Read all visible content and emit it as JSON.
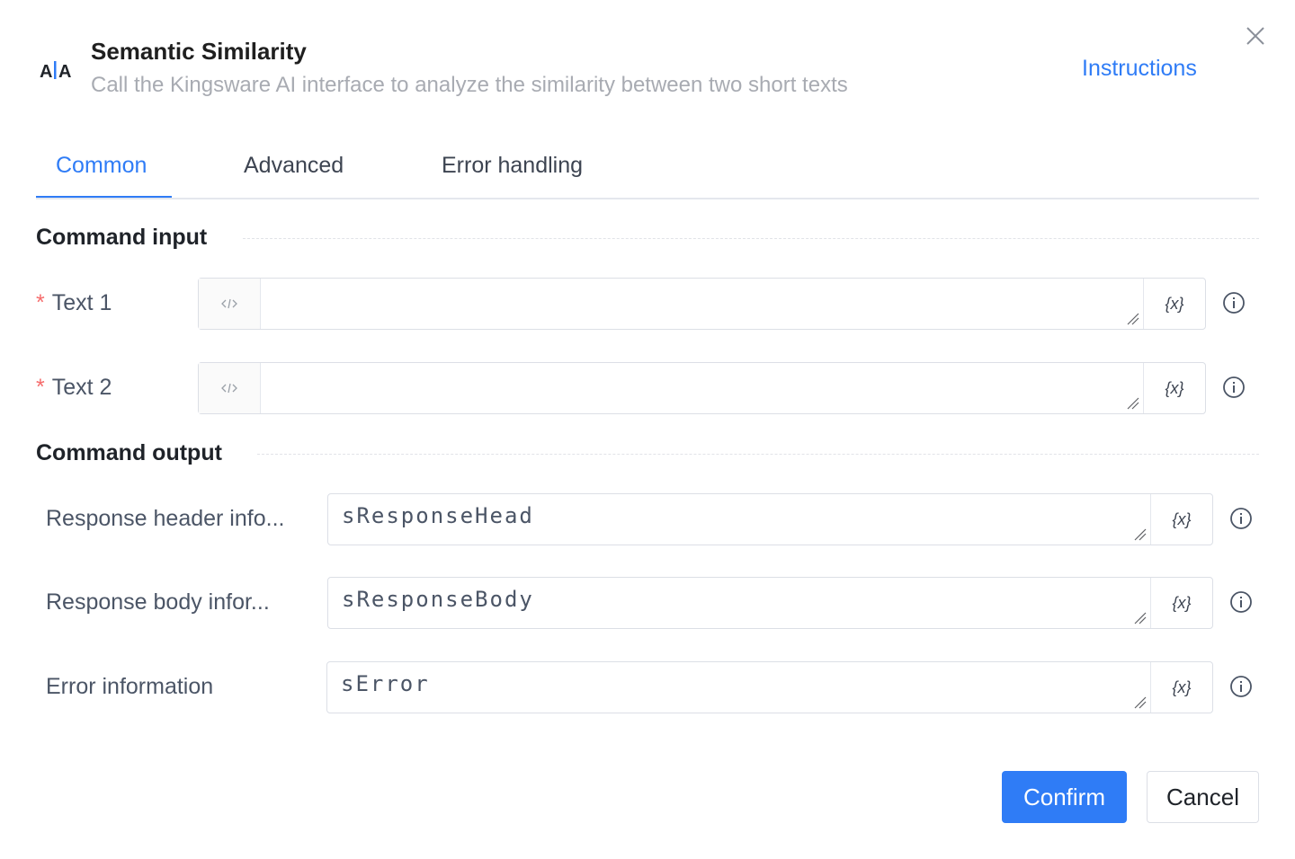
{
  "header": {
    "icon": "ai-text-compare-icon",
    "title": "Semantic Similarity",
    "subtitle": "Call the Kingsware AI interface to analyze the similarity between two short texts",
    "instructions_label": "Instructions"
  },
  "tabs": [
    {
      "label": "Common",
      "active": true
    },
    {
      "label": "Advanced",
      "active": false
    },
    {
      "label": "Error handling",
      "active": false
    }
  ],
  "input_section": {
    "title": "Command input",
    "fields": [
      {
        "label": "Text 1",
        "required": true,
        "value": ""
      },
      {
        "label": "Text 2",
        "required": true,
        "value": ""
      }
    ]
  },
  "output_section": {
    "title": "Command output",
    "fields": [
      {
        "label": "Response header info...",
        "value": "sResponseHead"
      },
      {
        "label": "Response body infor...",
        "value": "sResponseBody"
      },
      {
        "label": "Error information",
        "value": "sError"
      }
    ]
  },
  "variable_button_label": "{x}",
  "footer": {
    "confirm_label": "Confirm",
    "cancel_label": "Cancel"
  },
  "colors": {
    "accent": "#2f7cf6",
    "required": "#f56c6c"
  }
}
